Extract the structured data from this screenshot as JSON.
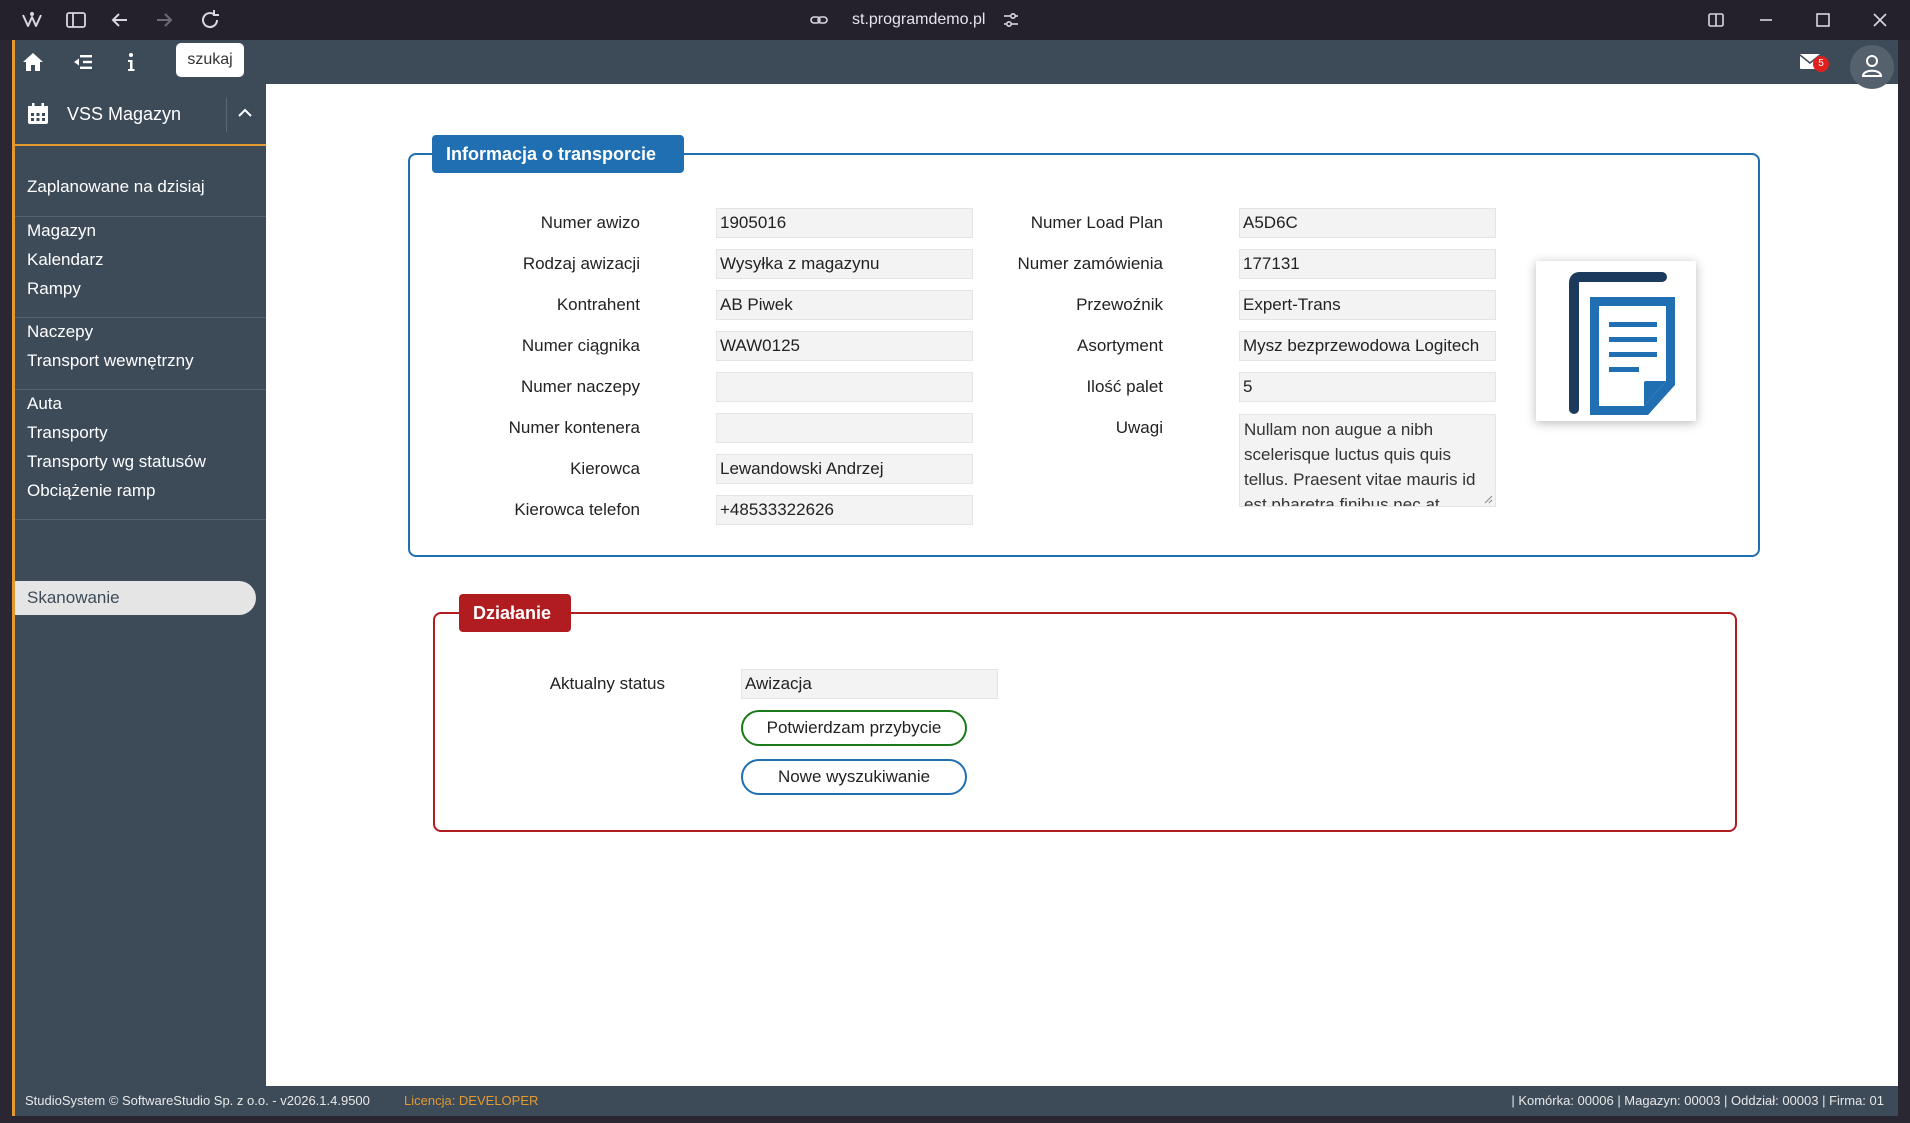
{
  "browser": {
    "url": "st.programdemo.pl",
    "icons": [
      "app-logo-icon",
      "sidebar-toggle-icon",
      "back-icon",
      "forward-icon",
      "reload-icon",
      "link-icon",
      "site-settings-icon",
      "split-view-icon",
      "minimize-icon",
      "maximize-icon",
      "close-icon"
    ]
  },
  "topbar": {
    "search_label": "szukaj",
    "mail_count": "5",
    "icons": [
      "home-icon",
      "menu-collapse-icon",
      "info-icon",
      "mail-icon",
      "user-icon"
    ]
  },
  "sidebar": {
    "title": "VSS Magazyn",
    "items": [
      {
        "label": "Zaplanowane na dzisiaj"
      },
      {
        "label": "Magazyn"
      },
      {
        "label": "Kalendarz"
      },
      {
        "label": "Rampy"
      },
      {
        "label": "Naczepy"
      },
      {
        "label": "Transport wewnętrzny"
      },
      {
        "label": "Auta"
      },
      {
        "label": "Transporty"
      },
      {
        "label": "Transporty wg statusów"
      },
      {
        "label": "Obciążenie ramp"
      },
      {
        "label": "Skanowanie"
      }
    ],
    "active": "Skanowanie"
  },
  "transport_info": {
    "title": "Informacja o transporcie",
    "left_fields": [
      {
        "label": "Numer awizo",
        "value": "1905016"
      },
      {
        "label": "Rodzaj awizacji",
        "value": "Wysyłka z magazynu"
      },
      {
        "label": "Kontrahent",
        "value": "AB Piwek"
      },
      {
        "label": "Numer ciągnika",
        "value": "WAW0125"
      },
      {
        "label": "Numer naczepy",
        "value": ""
      },
      {
        "label": "Numer kontenera",
        "value": ""
      },
      {
        "label": "Kierowca",
        "value": "Lewandowski Andrzej"
      },
      {
        "label": "Kierowca telefon",
        "value": "+48533322626"
      }
    ],
    "right_fields": [
      {
        "label": "Numer Load Plan",
        "value": "A5D6C"
      },
      {
        "label": "Numer zamówienia",
        "value": "177131"
      },
      {
        "label": "Przewoźnik",
        "value": "Expert-Trans"
      },
      {
        "label": "Asortyment",
        "value": "Mysz bezprzewodowa Logitech"
      },
      {
        "label": "Ilość palet",
        "value": "5"
      }
    ],
    "notes_label": "Uwagi",
    "notes_value": "Nullam non augue a nibh scelerisque luctus quis quis tellus. Praesent vitae mauris id est pharetra finibus nec at"
  },
  "action": {
    "title": "Działanie",
    "status_label": "Aktualny status",
    "status_value": "Awizacja",
    "confirm_button": "Potwierdzam przybycie",
    "new_search_button": "Nowe wyszukiwanie"
  },
  "footer": {
    "copyright": "StudioSystem © SoftwareStudio Sp. z o.o. - v2026.1.4.9500",
    "license_label": "Licencja: ",
    "license_value": "DEVELOPER",
    "context": "| Komórka: 00006 | Magazyn: 00003 | Oddział: 00003 | Firma: 01"
  },
  "colors": {
    "accent_orange": "#e29a2f",
    "sidebar_bg": "#3d4b59",
    "info_blue": "#1f6fb2",
    "action_red": "#b01c20",
    "confirm_green": "#1a7a1a"
  }
}
